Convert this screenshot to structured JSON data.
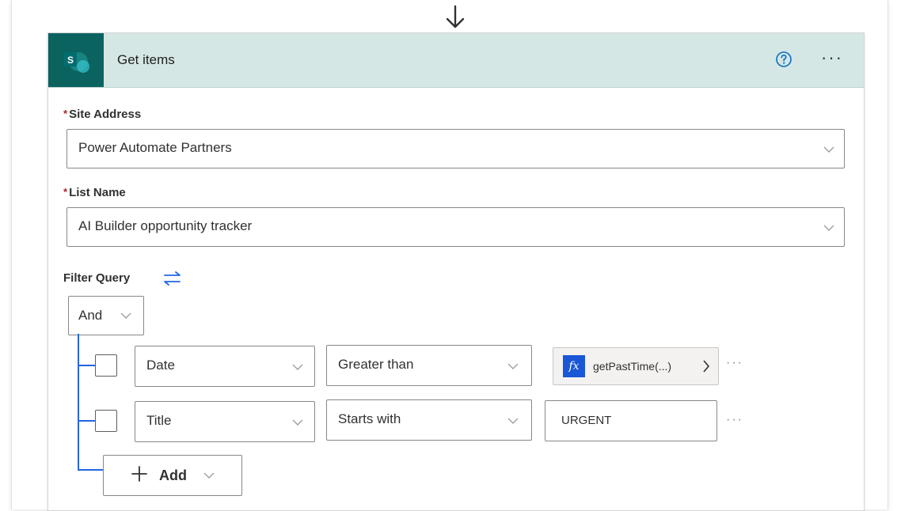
{
  "card": {
    "title": "Get items",
    "connector_icon": "sharepoint-icon",
    "header_color": "#d4e7e4",
    "connector_color": "#0b6360"
  },
  "fields": {
    "site_address": {
      "required_mark": "*",
      "label": "Site Address",
      "value": "Power Automate Partners"
    },
    "list_name": {
      "required_mark": "*",
      "label": "List Name",
      "value": "AI Builder opportunity tracker"
    }
  },
  "filter": {
    "label": "Filter Query",
    "group_operator": "And",
    "rows": [
      {
        "field": "Date",
        "operator": "Greater than",
        "value_token": "getPastTime(...)",
        "token_icon": "fx"
      },
      {
        "field": "Title",
        "operator": "Starts with",
        "value": "URGENT"
      }
    ],
    "add_label": "Add",
    "accent_color": "#2266e3"
  }
}
